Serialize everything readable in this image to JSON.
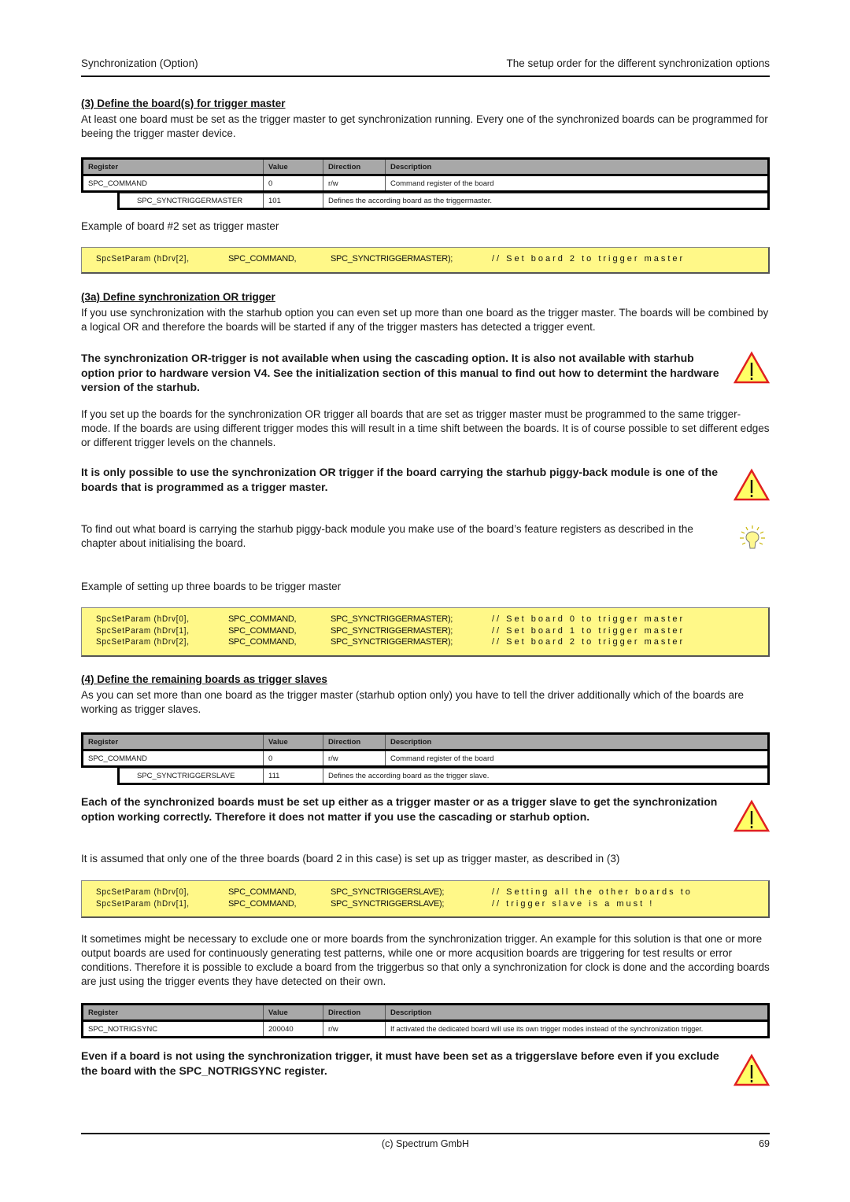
{
  "header": {
    "left": "Synchronization (Option)",
    "right": "The setup order for the different synchronization options"
  },
  "section3": {
    "title": "(3) Define the board(s) for trigger master",
    "intro": "At least one board must be set as the trigger master to get synchronization running. Every one of the synchronized boards can be programmed for beeing the trigger master device.",
    "table": {
      "headers": [
        "Register",
        "Value",
        "Direction",
        "Description"
      ],
      "row1": [
        "SPC_COMMAND",
        "0",
        "r/w",
        "Command register of the board"
      ],
      "row2": [
        "SPC_SYNCTRIGGERMASTER",
        "101",
        "Defines the according board as the triggermaster."
      ]
    },
    "example_label": "Example of board #2 set as trigger master",
    "code": [
      [
        "SpcSetParam (hDrv[2],",
        "SPC_COMMAND,",
        "SPC_SYNCTRIGGERMASTER);",
        "// Set board 2 to trigger master"
      ]
    ]
  },
  "section3a": {
    "title": "(3a) Define synchronization OR trigger",
    "intro": "If you use synchronization with the starhub option you can even set up more than one board as the trigger master. The boards will be combined by a logical OR and therefore the boards will be started if any of the trigger masters has detected a trigger event.",
    "warning1": "The synchronization OR-trigger is not available when using the cascading option. It is also not available with starhub option prior to hardware version V4. See the initialization section of this manual to find out how to determint the hardware version of the starhub.",
    "para2": "If you set up the boards for the synchronization OR trigger all boards that are set as trigger master must be programmed to the same trigger-mode. If the boards are using different trigger modes this will result in a time shift between the boards. It is of course possible to set different edges or different trigger levels on the channels.",
    "warning2": "It is only possible to use the synchronization OR trigger if the board carrying the starhub piggy-back module is one of the boards that is programmed as a trigger master.",
    "tip": "To find out what board is carrying the starhub piggy-back module you make use of the board’s feature registers as described in the chapter about initialising the board.",
    "example_label": "Example of setting up three boards to be trigger master",
    "code": [
      [
        "SpcSetParam (hDrv[0],",
        "SPC_COMMAND,",
        "SPC_SYNCTRIGGERMASTER);",
        "// Set board 0 to trigger master"
      ],
      [
        "SpcSetParam (hDrv[1],",
        "SPC_COMMAND,",
        "SPC_SYNCTRIGGERMASTER);",
        "// Set board 1 to trigger master"
      ],
      [
        "SpcSetParam (hDrv[2],",
        "SPC_COMMAND,",
        "SPC_SYNCTRIGGERMASTER);",
        "// Set board 2 to trigger master"
      ]
    ]
  },
  "section4": {
    "title": "(4) Define the remaining boards as trigger slaves",
    "intro": "As you can set more than one board as the trigger master (starhub option only) you have to tell the driver additionally which of the boards are working as trigger slaves.",
    "table": {
      "headers": [
        "Register",
        "Value",
        "Direction",
        "Description"
      ],
      "row1": [
        "SPC_COMMAND",
        "0",
        "r/w",
        "Command register of the board"
      ],
      "row2": [
        "SPC_SYNCTRIGGERSLAVE",
        "111",
        "Defines the according board as the trigger slave."
      ]
    },
    "warning": "Each of the synchronized boards must be set up either as a trigger master or as a trigger slave to get the synchronization option working correctly. Therefore it does not matter if you use the cascading or starhub option.",
    "example_label": "It is assumed that only one of the three boards (board 2 in this case) is set up as trigger master, as described in (3)",
    "code": [
      [
        "SpcSetParam (hDrv[0],",
        "SPC_COMMAND,",
        "SPC_SYNCTRIGGERSLAVE);",
        "// Setting all the other boards to"
      ],
      [
        "SpcSetParam (hDrv[1],",
        "SPC_COMMAND,",
        "SPC_SYNCTRIGGERSLAVE);",
        "// trigger slave is a must !"
      ]
    ],
    "para2": "It sometimes might be necessary to exclude one or more boards from the synchronization trigger. An example for this solution is that one or more output boards are used for continuously generating test patterns, while one or more acqusition boards are triggering for test results or error conditions. Therefore it is possible to exclude a board from the triggerbus so that only a synchronization for clock is done and the according boards are just using the trigger events they have detected on their own.",
    "table2": {
      "headers": [
        "Register",
        "Value",
        "Direction",
        "Description"
      ],
      "row1": [
        "SPC_NOTRIGSYNC",
        "200040",
        "r/w",
        "If activated the dedicated board will use its own trigger modes instead of the synchronization trigger."
      ]
    },
    "warning2": "Even if a board is not using the synchronization trigger, it must have been set as a triggerslave before even if you exclude the board with the SPC_NOTRIGSYNC register."
  },
  "icons": {
    "warning": "warning-triangle-icon",
    "tip": "lightbulb-icon"
  },
  "colors": {
    "code_bg": "#fff888",
    "table_header_bg": "#a8a8a8",
    "warning_fill": "#ffff66",
    "warning_stroke": "#e02020"
  },
  "footer": {
    "center": "(c) Spectrum GmbH",
    "page": "69"
  }
}
